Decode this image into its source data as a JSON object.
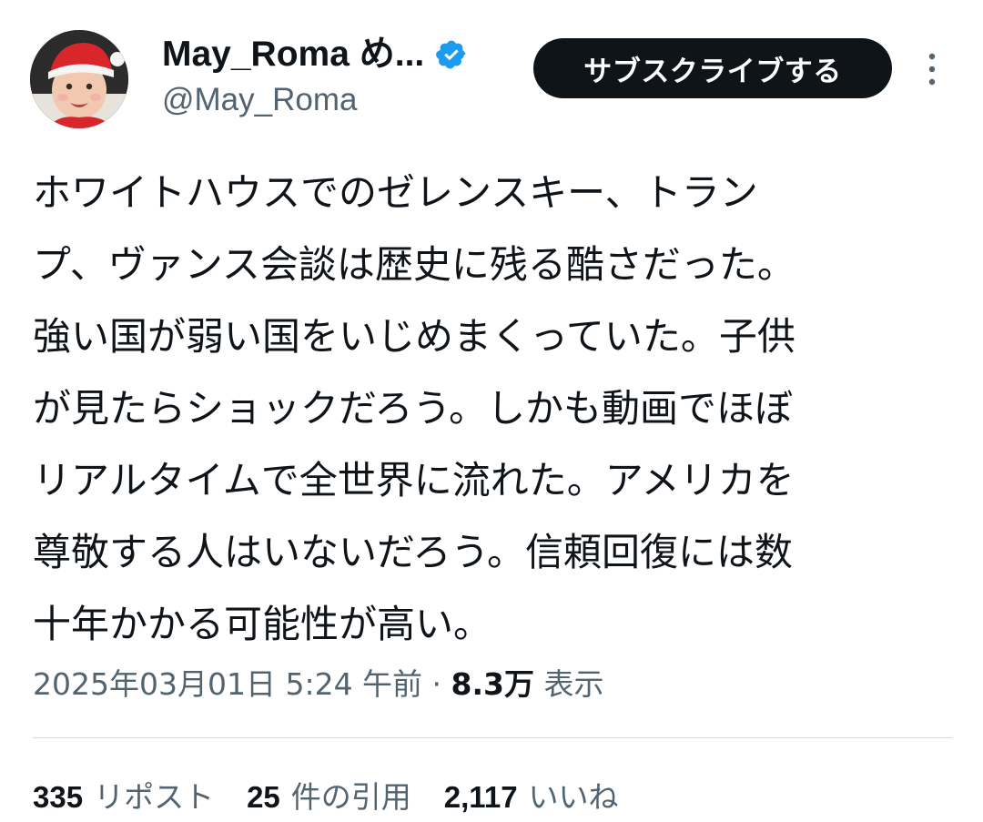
{
  "author": {
    "display_name": "May_Roma め...",
    "handle": "@May_Roma",
    "avatar_icon": "avatar-photo",
    "verified_icon": "verified-badge-icon",
    "verified_color": "#1d9bf0"
  },
  "header": {
    "subscribe_label": "サブスクライブする",
    "more_icon": "more-vertical-icon"
  },
  "tweet": {
    "lines": [
      "ホワイトハウスでのゼレンスキー、トラン",
      "プ、ヴァンス会談は歴史に残る酷さだった。",
      "強い国が弱い国をいじめまくっていた。子供",
      "が見たらショックだろう。しかも動画でほぼ",
      "リアルタイムで全世界に流れた。アメリカを",
      "尊敬する人はいないだろう。信頼回復には数",
      "十年かかる可能性が高い。"
    ]
  },
  "meta": {
    "timestamp": "2025年03月01日 5:24 午前",
    "separator": " · ",
    "views_count": "8.3万",
    "views_label": " 表示"
  },
  "stats": [
    {
      "count": "335",
      "label": "リポスト"
    },
    {
      "count": "25",
      "label": "件の引用"
    },
    {
      "count": "2,117",
      "label": "いいね"
    }
  ],
  "colors": {
    "text_primary": "#0f1419",
    "text_secondary": "#536471",
    "button_bg": "#0f1419",
    "divider": "#cfd9de"
  }
}
